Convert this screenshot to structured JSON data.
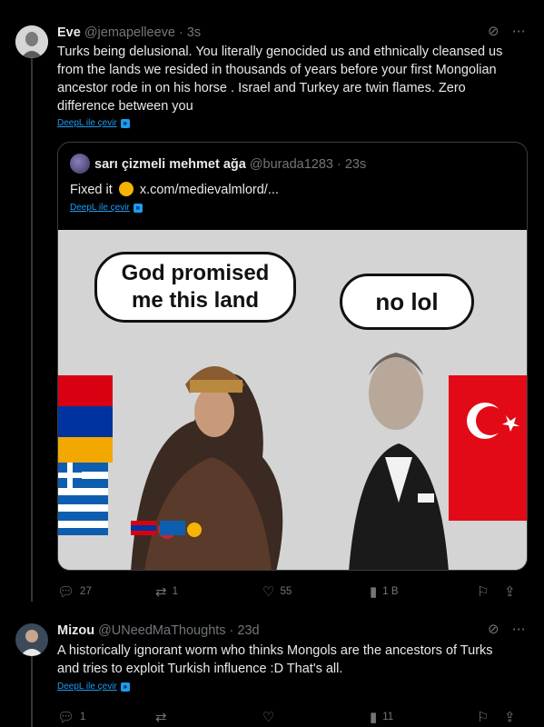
{
  "post1": {
    "name": "Eve",
    "handle": "@jemapelleeve",
    "time": "· 3s",
    "lines": [
      "Turks being delusional. You literally genocided us and ethnically cleansed us",
      "from the lands we resided in thousands of years before your first Mongolian",
      "ancestor rode in on his horse . Israel and Turkey are twin flames. Zero",
      "difference between you"
    ],
    "translate": "DeepL ile çevir",
    "quote": {
      "name": "sarı çizmeli mehmet ağa",
      "handle": "@burada1283",
      "time": "· 23s",
      "text_before": "Fixed it",
      "text_after": "x.com/medievalmlord/...",
      "translate": "DeepL ile çevir",
      "meme_left": [
        "God promised",
        "me this land"
      ],
      "meme_right": "no lol"
    },
    "actions": {
      "replies": "27",
      "reposts": "1",
      "likes": "55",
      "views": "1 B"
    }
  },
  "post2": {
    "name": "Mizou",
    "handle": "@UNeedMaThoughts",
    "time": "· 23d",
    "lines": [
      "A historically ignorant worm who thinks Mongols are the ancestors of Turks",
      "and tries to exploit Turkish influence :D That's all."
    ],
    "translate": "DeepL ile çevir",
    "actions": {
      "replies": "1",
      "reposts": "",
      "likes": "",
      "views": "11"
    }
  },
  "icons": {
    "grok": "slash-circle-icon",
    "more": "more-icon",
    "reply": "reply-icon",
    "repost": "repost-icon",
    "like": "heart-icon",
    "views": "views-icon",
    "bookmark": "bookmark-icon",
    "share": "share-icon"
  },
  "colors": {
    "link": "#1d9bf0",
    "muted": "#71767b",
    "text": "#e7e9ea",
    "divider": "#2f3336"
  }
}
